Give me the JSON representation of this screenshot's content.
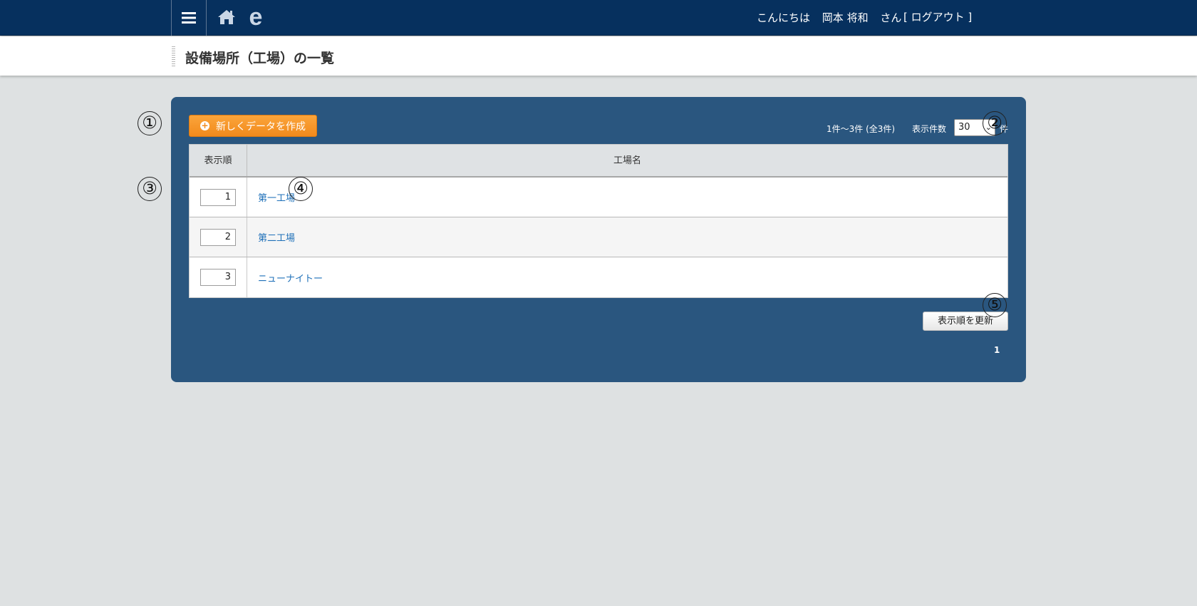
{
  "header": {
    "greeting": "こんにちは",
    "user_name": "岡本 将和",
    "honorific": "さん",
    "logout_label": "[ ログアウト ]",
    "logo_text": "e"
  },
  "page": {
    "title": "設備場所（工場）の一覧"
  },
  "toolbar": {
    "create_label": "新しくデータを作成",
    "range_text": "1件～3件 (全3件)",
    "per_page_label": "表示件数",
    "per_page_value": "30",
    "per_page_unit": "件"
  },
  "table": {
    "headers": {
      "order": "表示順",
      "name": "工場名"
    },
    "rows": [
      {
        "order": "1",
        "name": "第一工場"
      },
      {
        "order": "2",
        "name": "第二工場"
      },
      {
        "order": "3",
        "name": "ニューナイトー"
      }
    ]
  },
  "footer": {
    "update_label": "表示順を更新",
    "page_number": "1"
  },
  "callouts": [
    "①",
    "②",
    "③",
    "④",
    "⑤"
  ],
  "colors": {
    "topbar": "#06305e",
    "panel": "#2a567f",
    "create_button": "#f28a1c",
    "link": "#1d6fb8",
    "background": "#dee1e2"
  }
}
